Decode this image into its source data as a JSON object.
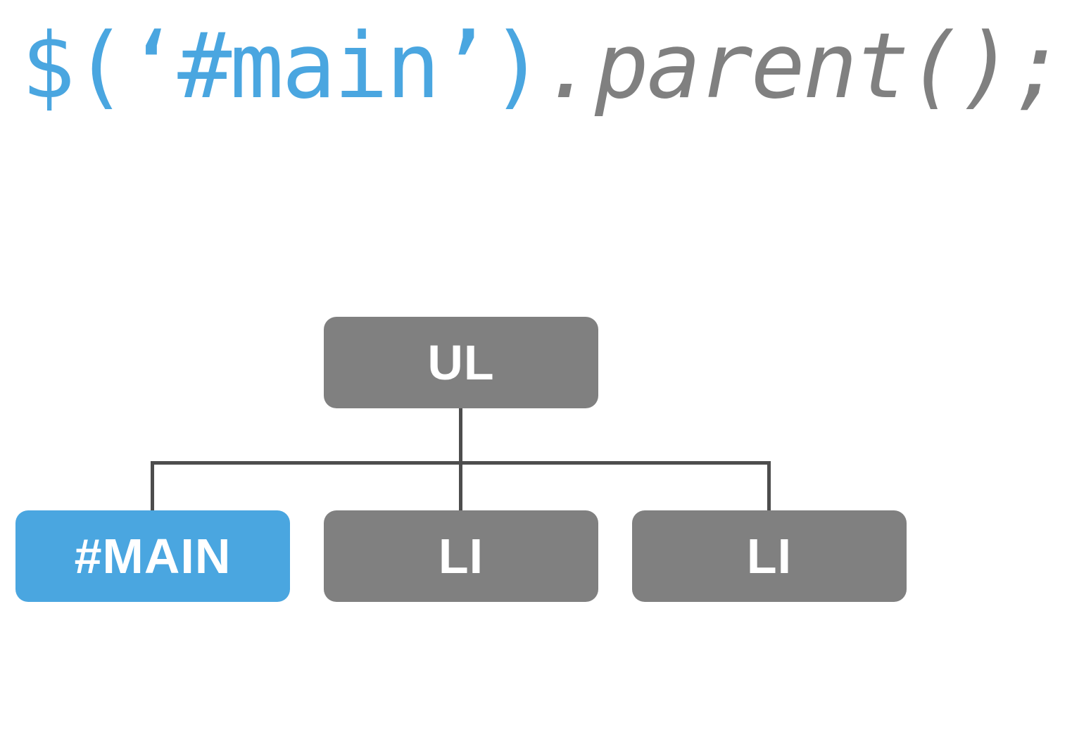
{
  "code": {
    "selector_part": "$(‘#main’)",
    "method_part": ".parent();"
  },
  "tree": {
    "root": "UL",
    "children": [
      {
        "label": "#MAIN",
        "highlighted": true
      },
      {
        "label": "LI",
        "highlighted": false
      },
      {
        "label": "LI",
        "highlighted": false
      }
    ]
  },
  "colors": {
    "blue": "#4AA6E0",
    "gray": "#808080",
    "connector": "#4D4D4D"
  }
}
